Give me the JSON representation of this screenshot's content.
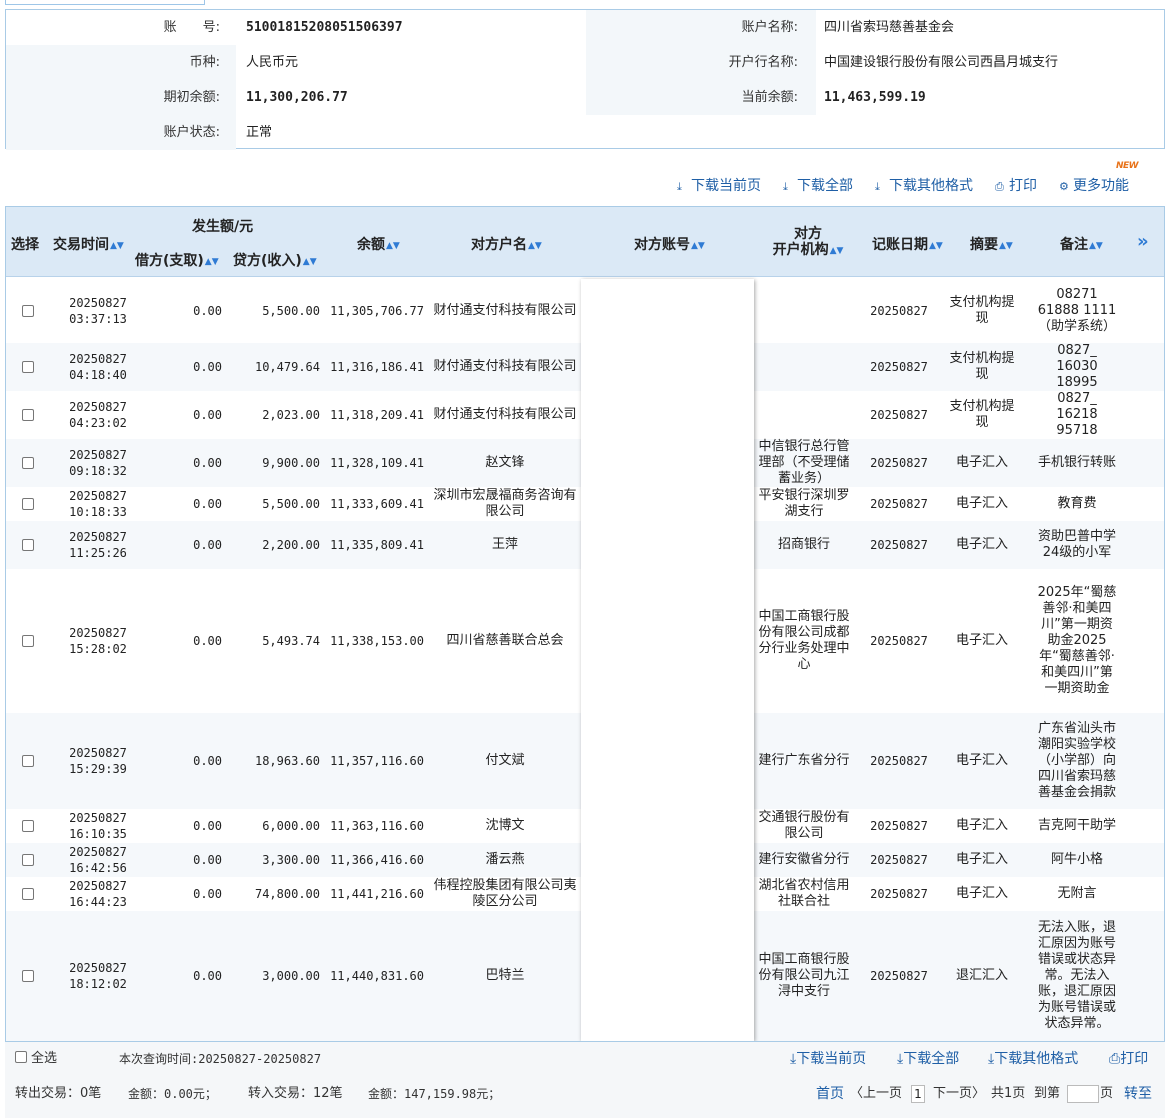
{
  "account": {
    "account_no_label": "账　　号:",
    "account_no": "51001815208051506397",
    "account_name_label": "账户名称:",
    "account_name": "四川省索玛慈善基金会",
    "currency_label": "币种:",
    "currency": "人民币元",
    "bank_label": "开户行名称:",
    "bank": "中国建设银行股份有限公司西昌月城支行",
    "opening_balance_label": "期初余额:",
    "opening_balance": "11,300,206.77",
    "current_balance_label": "当前余额:",
    "current_balance": "11,463,599.19",
    "status_label": "账户状态:",
    "status": "正常"
  },
  "toolbar": {
    "download_page": "下载当前页",
    "download_all": "下载全部",
    "download_other": "下载其他格式",
    "print": "打印",
    "more": "更多功能",
    "new_badge": "NEW"
  },
  "table": {
    "headers": {
      "select": "选择",
      "time": "交易时间",
      "amount_group": "发生额/元",
      "debit": "借方(支取)",
      "credit": "贷方(收入)",
      "balance": "余额",
      "counterparty_name": "对方户名",
      "counterparty_account": "对方账号",
      "counterparty_bank_1": "对方",
      "counterparty_bank_2": "开户机构",
      "post_date": "记账日期",
      "summary": "摘要",
      "remark": "备注"
    },
    "rows": [
      {
        "date": "20250827",
        "time": "03:37:13",
        "debit": "0.00",
        "credit": "5,500.00",
        "balance": "11,305,706.77",
        "name": "财付通支付科技有限公司",
        "bank": "",
        "post": "20250827",
        "summary": "支付机构提现",
        "remark": "08271 61888 1111（助学系统）"
      },
      {
        "date": "20250827",
        "time": "04:18:40",
        "debit": "0.00",
        "credit": "10,479.64",
        "balance": "11,316,186.41",
        "name": "财付通支付科技有限公司",
        "bank": "",
        "post": "20250827",
        "summary": "支付机构提现",
        "remark": "0827_ 16030 18995"
      },
      {
        "date": "20250827",
        "time": "04:23:02",
        "debit": "0.00",
        "credit": "2,023.00",
        "balance": "11,318,209.41",
        "name": "财付通支付科技有限公司",
        "bank": "",
        "post": "20250827",
        "summary": "支付机构提现",
        "remark": "0827_ 16218 95718"
      },
      {
        "date": "20250827",
        "time": "09:18:32",
        "debit": "0.00",
        "credit": "9,900.00",
        "balance": "11,328,109.41",
        "name": "赵文锋",
        "bank": "中信银行总行管理部（不受理储蓄业务）",
        "post": "20250827",
        "summary": "电子汇入",
        "remark": "手机银行转账"
      },
      {
        "date": "20250827",
        "time": "10:18:33",
        "debit": "0.00",
        "credit": "5,500.00",
        "balance": "11,333,609.41",
        "name": "深圳市宏晟福商务咨询有限公司",
        "bank": "平安银行深圳罗湖支行",
        "post": "20250827",
        "summary": "电子汇入",
        "remark": "教育费"
      },
      {
        "date": "20250827",
        "time": "11:25:26",
        "debit": "0.00",
        "credit": "2,200.00",
        "balance": "11,335,809.41",
        "name": "王萍",
        "bank": "招商银行",
        "post": "20250827",
        "summary": "电子汇入",
        "remark": "资助巴普中学24级的小军"
      },
      {
        "date": "20250827",
        "time": "15:28:02",
        "debit": "0.00",
        "credit": "5,493.74",
        "balance": "11,338,153.00",
        "name": "四川省慈善联合总会",
        "bank": "中国工商银行股份有限公司成都分行业务处理中心",
        "post": "20250827",
        "summary": "电子汇入",
        "remark": "2025年“蜀慈善邻·和美四川”第一期资助金2025年“蜀慈善邻·和美四川”第一期资助金"
      },
      {
        "date": "20250827",
        "time": "15:29:39",
        "debit": "0.00",
        "credit": "18,963.60",
        "balance": "11,357,116.60",
        "name": "付文斌",
        "bank": "建行广东省分行",
        "post": "20250827",
        "summary": "电子汇入",
        "remark": "广东省汕头市潮阳实验学校（小学部）向四川省索玛慈善基金会捐款"
      },
      {
        "date": "20250827",
        "time": "16:10:35",
        "debit": "0.00",
        "credit": "6,000.00",
        "balance": "11,363,116.60",
        "name": "沈博文",
        "bank": "交通银行股份有限公司",
        "post": "20250827",
        "summary": "电子汇入",
        "remark": "吉克阿干助学"
      },
      {
        "date": "20250827",
        "time": "16:42:56",
        "debit": "0.00",
        "credit": "3,300.00",
        "balance": "11,366,416.60",
        "name": "潘云燕",
        "bank": "建行安徽省分行",
        "post": "20250827",
        "summary": "电子汇入",
        "remark": "阿牛小格"
      },
      {
        "date": "20250827",
        "time": "16:44:23",
        "debit": "0.00",
        "credit": "74,800.00",
        "balance": "11,441,216.60",
        "name": "伟程控股集团有限公司夷陵区分公司",
        "bank": "湖北省农村信用社联合社",
        "post": "20250827",
        "summary": "电子汇入",
        "remark": "无附言"
      },
      {
        "date": "20250827",
        "time": "18:12:02",
        "debit": "0.00",
        "credit": "3,000.00",
        "balance": "11,440,831.60",
        "name": "巴特兰",
        "bank": "中国工商银行股份有限公司九江浔中支行",
        "post": "20250827",
        "summary": "退汇汇入",
        "remark": "无法入账，退汇原因为账号错误或状态异常。无法入账，退汇原因为账号错误或状态异常。"
      }
    ]
  },
  "footer": {
    "select_all": "全选",
    "query_time": "本次查询时间:20250827-20250827",
    "download_page": "下载当前页",
    "download_all": "下载全部",
    "download_other": "下载其他格式",
    "print": "打印",
    "out_count": "转出交易：0笔",
    "out_amount": "金额：0.00元；",
    "in_count": "转入交易：12笔",
    "in_amount": "金额：147,159.98元；",
    "first": "首页",
    "prev": "〈上一页",
    "page": "1",
    "next": "下一页〉",
    "total": "共1页",
    "goto_pre": "到第",
    "goto_post": "页",
    "go": "转至"
  }
}
